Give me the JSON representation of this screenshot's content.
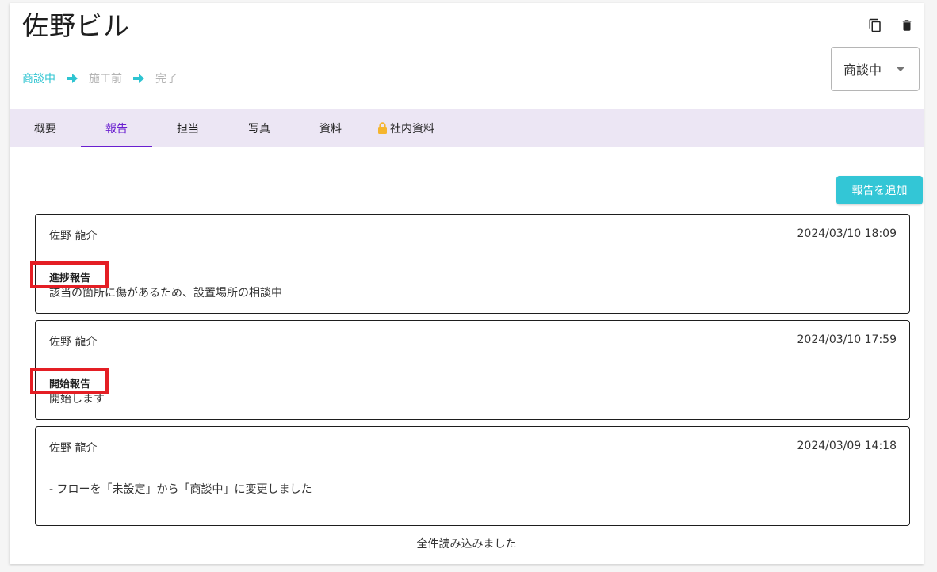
{
  "header": {
    "title": "佐野ビル",
    "copy_icon": "copy-icon",
    "delete_icon": "trash-icon"
  },
  "flow": {
    "steps": [
      "商談中",
      "施工前",
      "完了"
    ],
    "active_index": 0
  },
  "status_select": {
    "value": "商談中"
  },
  "tabs": [
    {
      "label": "概要"
    },
    {
      "label": "報告",
      "active": true
    },
    {
      "label": "担当"
    },
    {
      "label": "写真"
    },
    {
      "label": "資料"
    },
    {
      "label": "社内資料",
      "icon": "lock-icon"
    }
  ],
  "add_button": {
    "label": "報告を追加"
  },
  "reports": [
    {
      "author": "佐野 龍介",
      "date": "2024/03/10 18:09",
      "type": "進捗報告",
      "body": "該当の箇所に傷があるため、設置場所の相談中"
    },
    {
      "author": "佐野 龍介",
      "date": "2024/03/10 17:59",
      "type": "開始報告",
      "body": "開始します"
    },
    {
      "author": "佐野 龍介",
      "date": "2024/03/09 14:18",
      "type": "",
      "body": "- フローを「未設定」から「商談中」に変更しました"
    }
  ],
  "footer": {
    "text": "全件読み込みました"
  },
  "colors": {
    "accent": "#33c6d6",
    "tab_active": "#6a1fd0",
    "tab_bar": "#ece6f4",
    "highlight": "#e41e24"
  }
}
